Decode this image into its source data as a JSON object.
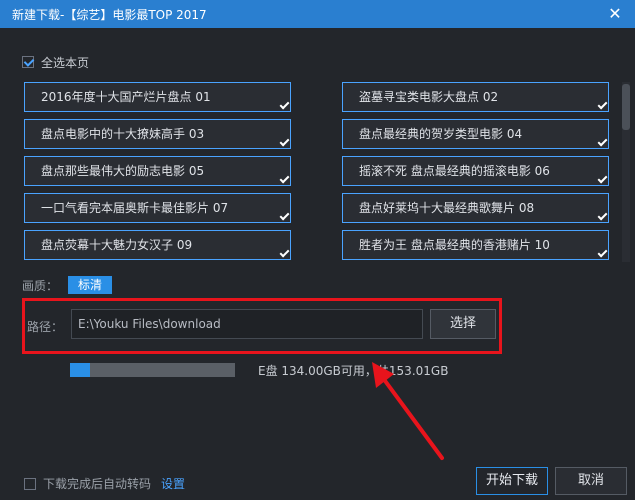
{
  "window": {
    "title": "新建下载-【综艺】电影最TOP 2017",
    "close_glyph": "✕"
  },
  "select_all": {
    "label": "全选本页",
    "checked": true
  },
  "videos": [
    {
      "title": "2016年度十大国产烂片盘点 01",
      "checked": true
    },
    {
      "title": "盗墓寻宝类电影大盘点 02",
      "checked": true
    },
    {
      "title": "盘点电影中的十大撩妹高手 03",
      "checked": true
    },
    {
      "title": "盘点最经典的贺岁类型电影 04",
      "checked": true
    },
    {
      "title": "盘点那些最伟大的励志电影 05",
      "checked": true
    },
    {
      "title": "摇滚不死 盘点最经典的摇滚电影 06",
      "checked": true
    },
    {
      "title": "一口气看完本届奥斯卡最佳影片 07",
      "checked": true
    },
    {
      "title": "盘点好莱坞十大最经典歌舞片 08",
      "checked": true
    },
    {
      "title": "盘点荧幕十大魅力女汉子 09",
      "checked": true
    },
    {
      "title": "胜者为王 盘点最经典的香港赌片 10",
      "checked": true
    }
  ],
  "quality": {
    "label": "画质：",
    "value": "标清"
  },
  "path": {
    "label": "路径：",
    "value": "E:\\Youku Files\\download",
    "browse_label": "选择"
  },
  "disk": {
    "text": "E盘 134.00GB可用，共153.01GB",
    "used_fraction": 0.124
  },
  "footer": {
    "auto_convert_label": "下载完成后自动转码",
    "auto_convert_checked": false,
    "settings_label": "设置",
    "start_label": "开始下载",
    "cancel_label": "取消"
  },
  "colors": {
    "accent": "#2a8fe6",
    "highlight_box": "#e8141c",
    "annotation_arrow": "#e8141c"
  },
  "icons": {
    "close": "close-icon",
    "checkbox": "checkbox-icon",
    "checkmark": "checkmark-icon",
    "arrow": "annotation-arrow-icon"
  }
}
